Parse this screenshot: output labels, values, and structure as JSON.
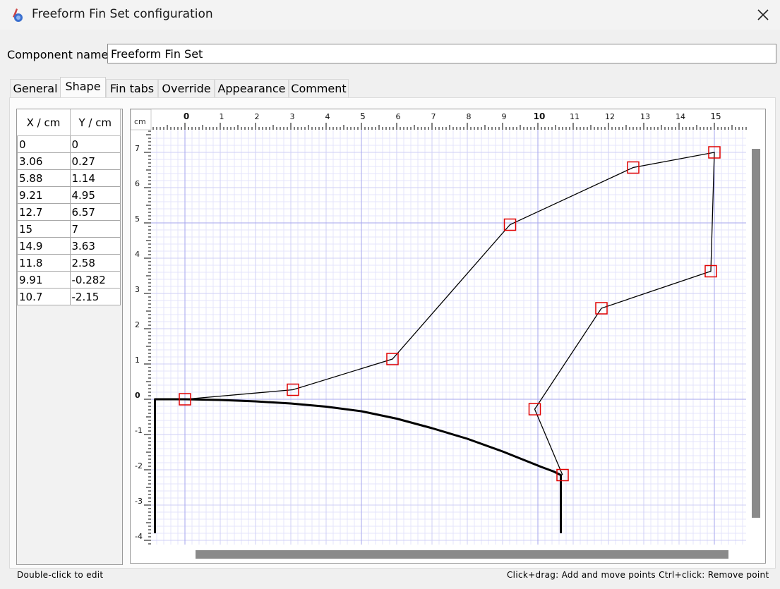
{
  "window": {
    "title": "Freeform Fin Set configuration",
    "icon": "rocket-app-icon"
  },
  "component": {
    "label": "Component name:",
    "value": "Freeform Fin Set"
  },
  "tabs": [
    {
      "label": "General"
    },
    {
      "label": "Shape"
    },
    {
      "label": "Fin tabs"
    },
    {
      "label": "Override"
    },
    {
      "label": "Appearance"
    },
    {
      "label": "Comment"
    }
  ],
  "active_tab": "Shape",
  "points_table": {
    "headers": [
      "X / cm",
      "Y / cm"
    ],
    "rows": [
      [
        "0",
        "0"
      ],
      [
        "3.06",
        "0.27"
      ],
      [
        "5.88",
        "1.14"
      ],
      [
        "9.21",
        "4.95"
      ],
      [
        "12.7",
        "6.57"
      ],
      [
        "15",
        "7"
      ],
      [
        "14.9",
        "3.63"
      ],
      [
        "11.8",
        "2.58"
      ],
      [
        "9.91",
        "-0.282"
      ],
      [
        "10.7",
        "-2.15"
      ]
    ]
  },
  "chart_data": {
    "type": "line",
    "unit_label": "cm",
    "xlim": [
      -1,
      16
    ],
    "ylim": [
      -4,
      7.5
    ],
    "x_ticks": [
      "0",
      "1",
      "2",
      "3",
      "4",
      "5",
      "6",
      "7",
      "8",
      "9",
      "10",
      "11",
      "12",
      "13",
      "14",
      "15"
    ],
    "y_ticks": [
      "7",
      "6",
      "5",
      "4",
      "3",
      "2",
      "1",
      "0",
      "-1",
      "-2",
      "-3",
      "-4"
    ],
    "fin_points": [
      [
        0,
        0
      ],
      [
        3.06,
        0.27
      ],
      [
        5.88,
        1.14
      ],
      [
        9.21,
        4.95
      ],
      [
        12.7,
        6.57
      ],
      [
        15,
        7
      ],
      [
        14.9,
        3.63
      ],
      [
        11.8,
        2.58
      ],
      [
        9.91,
        -0.282
      ],
      [
        10.7,
        -2.15
      ]
    ],
    "body_profile": [
      [
        -0.85,
        -3.8
      ],
      [
        -0.85,
        0
      ],
      [
        0,
        0
      ],
      [
        1,
        -0.02
      ],
      [
        2,
        -0.06
      ],
      [
        3,
        -0.12
      ],
      [
        4,
        -0.21
      ],
      [
        5,
        -0.34
      ],
      [
        6,
        -0.55
      ],
      [
        7,
        -0.82
      ],
      [
        8,
        -1.12
      ],
      [
        9,
        -1.48
      ],
      [
        9.6,
        -1.72
      ],
      [
        10.1,
        -1.92
      ],
      [
        10.45,
        -2.05
      ],
      [
        10.65,
        -2.15
      ],
      [
        10.65,
        -3.8
      ]
    ],
    "colors": {
      "grid_minor": "#e4e4fb",
      "grid_major": "#a6a6ee",
      "point_marker": "#e00000",
      "line": "#000000"
    }
  },
  "hints": {
    "left": "Double-click to edit",
    "right": "Click+drag: Add and move points  Ctrl+click: Remove point"
  }
}
